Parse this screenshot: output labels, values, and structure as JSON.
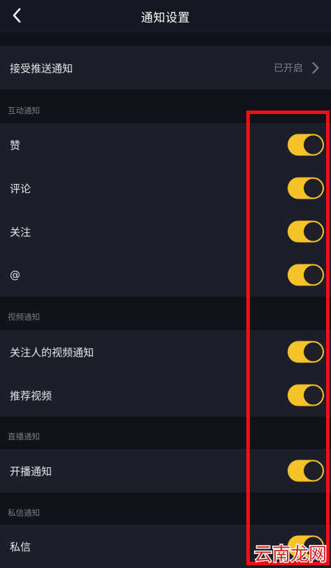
{
  "header": {
    "title": "通知设置"
  },
  "push": {
    "label": "接受推送通知",
    "value": "已开启"
  },
  "sections": {
    "interaction": {
      "title": "互动通知",
      "items": [
        {
          "label": "赞",
          "enabled": true
        },
        {
          "label": "评论",
          "enabled": true
        },
        {
          "label": "关注",
          "enabled": true
        },
        {
          "label": "@",
          "enabled": true
        }
      ]
    },
    "video": {
      "title": "视频通知",
      "items": [
        {
          "label": "关注人的视频通知",
          "enabled": true
        },
        {
          "label": "推荐视频",
          "enabled": true
        }
      ]
    },
    "live": {
      "title": "直播通知",
      "items": [
        {
          "label": "开播通知",
          "enabled": true
        }
      ]
    },
    "message": {
      "title": "私信通知",
      "items": [
        {
          "label": "私信",
          "enabled": true
        }
      ]
    }
  },
  "watermark": {
    "text": "云南龙网"
  },
  "colors": {
    "background": "#161823",
    "row": "#1c1e29",
    "toggle_on": "#f5c22a",
    "highlight": "#ef0f14",
    "watermark": "#d3221f"
  },
  "icons": {
    "back": "chevron-left-icon",
    "disclosure": "chevron-right-icon"
  }
}
